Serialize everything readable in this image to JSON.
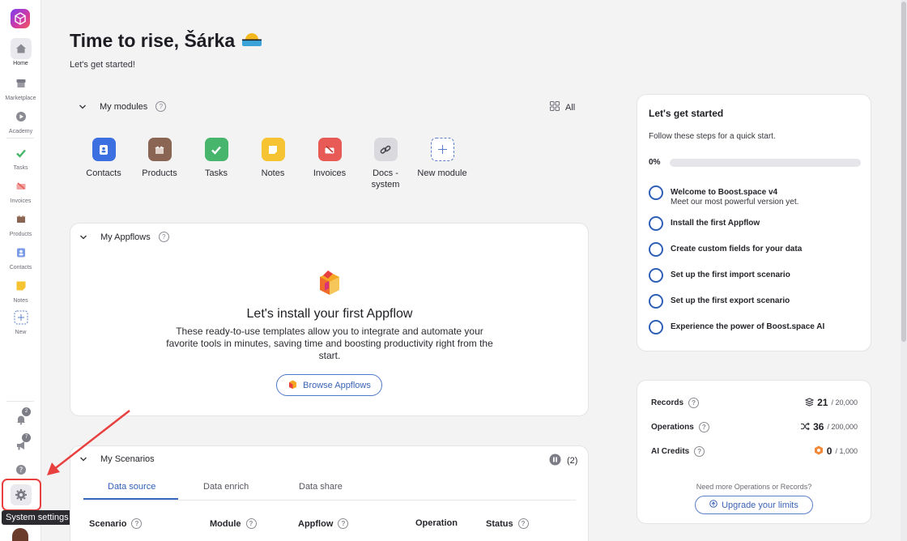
{
  "greeting": {
    "title": "Time to rise, Šárka",
    "emoji": "🌅",
    "subtitle": "Let's get started!"
  },
  "rail": {
    "items": [
      {
        "label": "Home",
        "icon": "home-icon"
      },
      {
        "label": "Marketplace",
        "icon": "store-icon"
      },
      {
        "label": "Academy",
        "icon": "play-icon"
      },
      {
        "label": "Tasks",
        "icon": "check-icon"
      },
      {
        "label": "Invoices",
        "icon": "invoice-icon"
      },
      {
        "label": "Products",
        "icon": "box-icon"
      },
      {
        "label": "Contacts",
        "icon": "contact-icon"
      },
      {
        "label": "Notes",
        "icon": "note-icon"
      },
      {
        "label": "New",
        "icon": "plus-icon"
      }
    ],
    "notifications_count": "2",
    "announcements_count": "7",
    "tooltip": "System settings"
  },
  "modules": {
    "title": "My modules",
    "all_label": "All",
    "items": [
      {
        "label": "Contacts",
        "color": "#3c6fe0"
      },
      {
        "label": "Products",
        "color": "#8a6553"
      },
      {
        "label": "Tasks",
        "color": "#47b56b"
      },
      {
        "label": "Notes",
        "color": "#f6c432"
      },
      {
        "label": "Invoices",
        "color": "#e85a55"
      },
      {
        "label": "Docs - system",
        "color": "#d9d9de"
      },
      {
        "label": "New module",
        "color": "#ffffff"
      }
    ]
  },
  "appflows": {
    "title": "My Appflows",
    "heading": "Let's install your first Appflow",
    "description": "These ready-to-use templates allow you to integrate and automate your favorite tools in minutes, saving time and boosting productivity right from the start.",
    "button": "Browse Appflows"
  },
  "scenarios": {
    "title": "My Scenarios",
    "count": "(2)",
    "tabs": [
      "Data source",
      "Data enrich",
      "Data share"
    ],
    "columns": [
      "Scenario",
      "Module",
      "Appflow",
      "Operation",
      "Status"
    ]
  },
  "getting_started": {
    "title": "Let's get started",
    "subtitle": "Follow these steps for a quick start.",
    "progress_label": "0%",
    "progress": 0,
    "steps": [
      {
        "title": "Welcome to Boost.space v4",
        "desc": "Meet our most powerful version yet."
      },
      {
        "title": "Install the first Appflow",
        "desc": ""
      },
      {
        "title": "Create custom fields for your data",
        "desc": ""
      },
      {
        "title": "Set up the first import scenario",
        "desc": ""
      },
      {
        "title": "Set up the first export scenario",
        "desc": ""
      },
      {
        "title": "Experience the power of Boost.space AI",
        "desc": ""
      }
    ]
  },
  "usage": {
    "rows": [
      {
        "label": "Records",
        "value": "21",
        "limit": "/ 20,000"
      },
      {
        "label": "Operations",
        "value": "36",
        "limit": "/ 200,000"
      },
      {
        "label": "AI Credits",
        "value": "0",
        "limit": "/ 1,000"
      }
    ],
    "need_more": "Need more Operations or Records?",
    "upgrade": "Upgrade your limits"
  },
  "colors": {
    "accent": "#2f5fb7",
    "highlight": "#e8403f"
  }
}
